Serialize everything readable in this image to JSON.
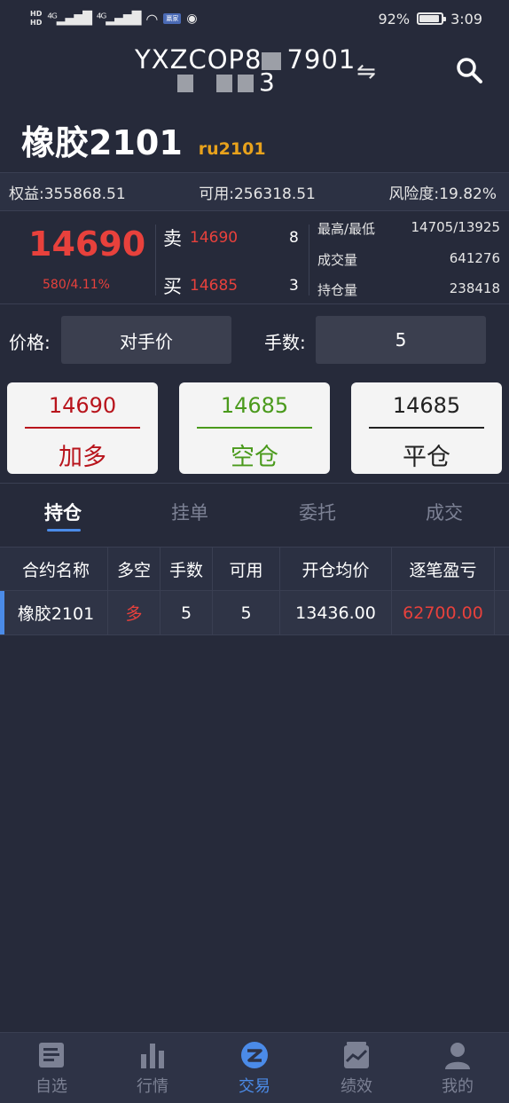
{
  "status_bar": {
    "battery": "92%",
    "time": "3:09",
    "app_badge": "赢家"
  },
  "header": {
    "account_line1": "YXZCOP8",
    "account_line1_b": "7901",
    "account_line2": "3"
  },
  "contract": {
    "name": "橡胶2101",
    "code": "ru2101"
  },
  "account": {
    "equity": "权益:355868.51",
    "available": "可用:256318.51",
    "risk": "风险度:19.82%"
  },
  "quote": {
    "last_price": "14690",
    "change": "580/4.11%",
    "ask_label": "卖",
    "ask_price": "14690",
    "ask_vol": "8",
    "bid_label": "买",
    "bid_price": "14685",
    "bid_vol": "3",
    "stats": [
      {
        "label": "最高/最低",
        "value": "14705/13925"
      },
      {
        "label": "成交量",
        "value": "641276"
      },
      {
        "label": "持仓量",
        "value": "238418"
      }
    ]
  },
  "order": {
    "price_label": "价格:",
    "price_value": "对手价",
    "qty_label": "手数:",
    "qty_value": "5"
  },
  "buttons": [
    {
      "price": "14690",
      "label": "加多",
      "color": "#b8141c"
    },
    {
      "price": "14685",
      "label": "空仓",
      "color": "#4a9a1c"
    },
    {
      "price": "14685",
      "label": "平仓",
      "color": "#222222"
    }
  ],
  "tabs": [
    "持仓",
    "挂单",
    "委托",
    "成交"
  ],
  "table": {
    "headers": [
      "合约名称",
      "多空",
      "手数",
      "可用",
      "开仓均价",
      "逐笔盈亏"
    ],
    "rows": [
      {
        "name": "橡胶2101",
        "side": "多",
        "qty": "5",
        "avail": "5",
        "avg": "13436.00",
        "pnl": "62700.00"
      }
    ]
  },
  "nav": [
    "自选",
    "行情",
    "交易",
    "绩效",
    "我的"
  ]
}
